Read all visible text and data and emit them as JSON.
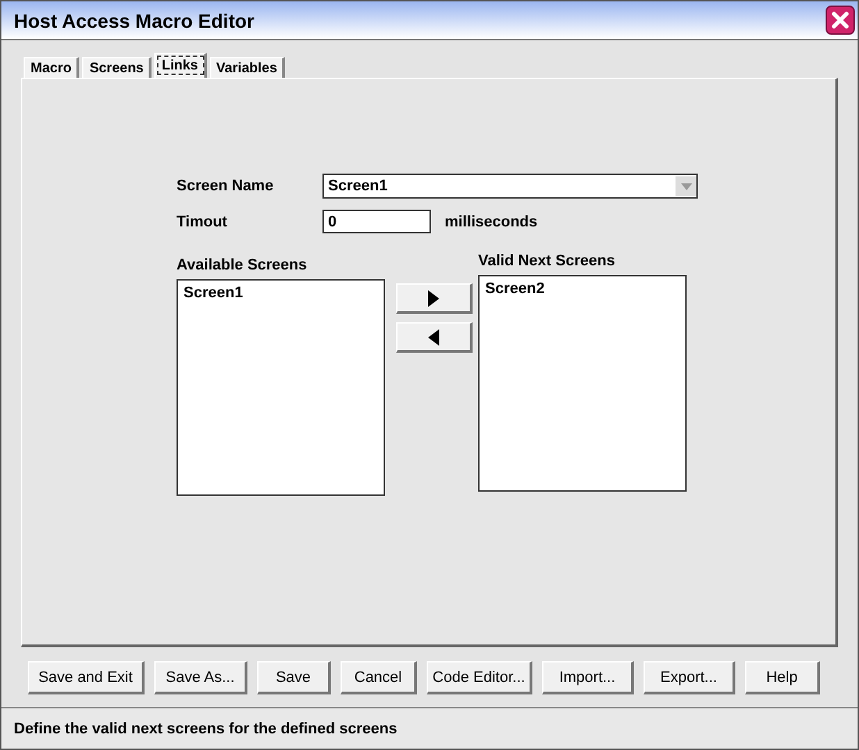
{
  "window": {
    "title": "Host Access Macro Editor"
  },
  "tabs": [
    {
      "label": "Macro",
      "selected": false
    },
    {
      "label": "Screens",
      "selected": false
    },
    {
      "label": "Links",
      "selected": true
    },
    {
      "label": "Variables",
      "selected": false
    }
  ],
  "form": {
    "screen_name": {
      "label": "Screen Name",
      "value": "Screen1"
    },
    "timeout": {
      "label": "Timout",
      "value": "0",
      "unit": "milliseconds"
    }
  },
  "available": {
    "label": "Available Screens",
    "items": [
      "Screen1"
    ]
  },
  "valid_next": {
    "label": "Valid Next Screens",
    "items": [
      "Screen2"
    ]
  },
  "buttons": [
    "Save and Exit",
    "Save As...",
    "Save",
    "Cancel",
    "Code Editor...",
    "Import...",
    "Export...",
    "Help"
  ],
  "status_bar": "Define the valid next screens for the defined screens"
}
